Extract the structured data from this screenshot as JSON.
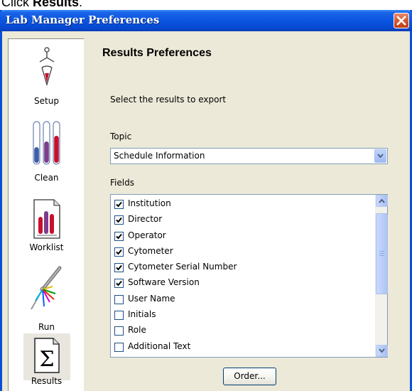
{
  "instruction": {
    "prefix": "Click ",
    "target": "Results",
    "suffix": "."
  },
  "window": {
    "title": "Lab Manager Preferences"
  },
  "sidebar": {
    "items": [
      {
        "label": "Setup",
        "icon": "setup-pipette-icon"
      },
      {
        "label": "Clean",
        "icon": "clean-test-tubes-icon"
      },
      {
        "label": "Worklist",
        "icon": "worklist-document-icon"
      },
      {
        "label": "Run",
        "icon": "run-laser-icon"
      },
      {
        "label": "Results",
        "icon": "results-sigma-icon",
        "selected": true
      }
    ]
  },
  "panel": {
    "title": "Results Preferences",
    "intro": "Select the results to export",
    "topic_label": "Topic",
    "topic_value": "Schedule Information",
    "fields_label": "Fields",
    "fields": [
      {
        "label": "Institution",
        "checked": true
      },
      {
        "label": "Director",
        "checked": true
      },
      {
        "label": "Operator",
        "checked": true
      },
      {
        "label": "Cytometer",
        "checked": true
      },
      {
        "label": "Cytometer Serial Number",
        "checked": true
      },
      {
        "label": "Software Version",
        "checked": true
      },
      {
        "label": "User Name",
        "checked": false
      },
      {
        "label": "Initials",
        "checked": false
      },
      {
        "label": "Role",
        "checked": false
      },
      {
        "label": "Additional Text",
        "checked": false
      }
    ],
    "order_button": "Order..."
  },
  "colors": {
    "titlebar": "#0a55e0",
    "window_bg": "#ece9d8",
    "close": "#d35a30",
    "scrollbar": "#b9cdf7"
  }
}
